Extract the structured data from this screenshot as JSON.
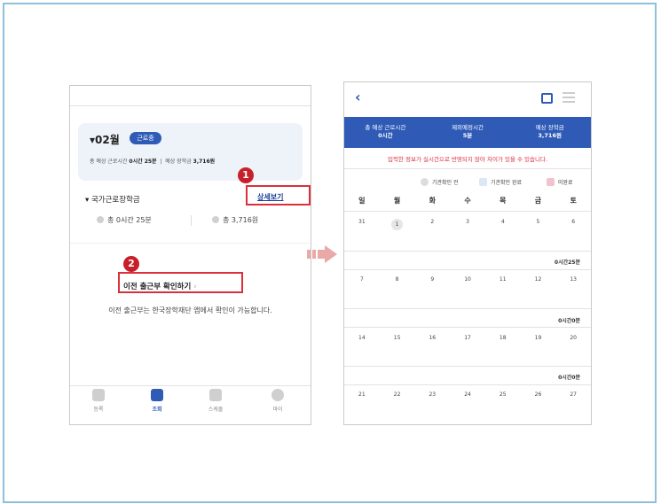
{
  "left": {
    "month": "▾02월",
    "badge": "근로중",
    "card_line_label1": "총 예상 근로시간",
    "card_line_value1": "0시간 25분",
    "card_line_label2": "예상 장학금",
    "card_line_value2": "3,716원",
    "scholar_title": "▾ 국가근로장학금",
    "detail_link": "상세보기",
    "stat_time": "총 0시간 25분",
    "stat_amount": "총 3,716원",
    "check_button": "이전 출근부 확인하기",
    "check_chevron": "›",
    "notice": "이전 출근부는 한국장학재단 앱에서 확인이 가능합니다.",
    "marker1": "1",
    "marker2": "2",
    "tabs": [
      {
        "label": "등록",
        "icon": "register-icon"
      },
      {
        "label": "조회",
        "icon": "search-icon"
      },
      {
        "label": "스케줄",
        "icon": "calendar-icon"
      },
      {
        "label": "마이",
        "icon": "profile-icon"
      }
    ]
  },
  "right": {
    "back": "‹",
    "summary": [
      {
        "label": "총 예상 근로시간",
        "value": "0시간"
      },
      {
        "label": "제외예정시간",
        "value": "5분"
      },
      {
        "label": "예상 장학금",
        "value": "3,716원"
      }
    ],
    "warning": "입력한 정보가 실시간으로 반영되지 않아 차이가 있을 수 있습니다.",
    "legend": [
      {
        "label": "기관확인 전",
        "color": "#dcdcdc"
      },
      {
        "label": "기관확인 완료",
        "color": "#dbe6f6"
      },
      {
        "label": "미완료",
        "color": "#f2c3cf"
      }
    ],
    "weekdays": [
      "일",
      "월",
      "화",
      "수",
      "목",
      "금",
      "토"
    ],
    "weeks": [
      {
        "days": [
          "31",
          "1",
          "2",
          "3",
          "4",
          "5",
          "6"
        ],
        "total": "0시간25분"
      },
      {
        "days": [
          "7",
          "8",
          "9",
          "10",
          "11",
          "12",
          "13"
        ],
        "total": "0시간0분"
      },
      {
        "days": [
          "14",
          "15",
          "16",
          "17",
          "18",
          "19",
          "20"
        ],
        "total": "0시간0분"
      },
      {
        "days": [
          "21",
          "22",
          "23",
          "24",
          "25",
          "26",
          "27"
        ],
        "total": ""
      }
    ]
  },
  "colors": {
    "accent": "#2f5bb7",
    "highlight": "#d9303b",
    "arrow": "#e9a9a7"
  }
}
